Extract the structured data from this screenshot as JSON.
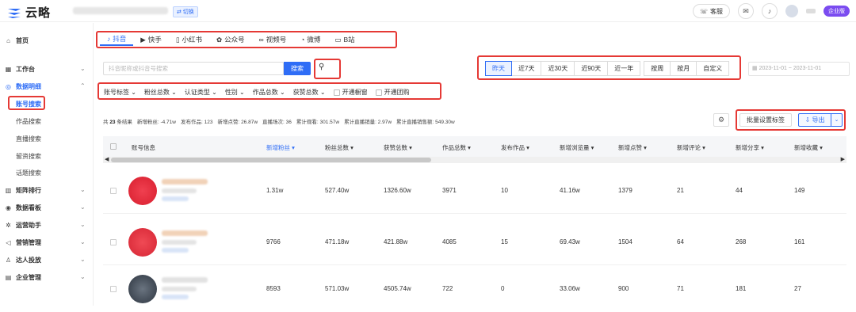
{
  "app": {
    "name": "云略",
    "switch_label": "⇄ 切换"
  },
  "topbar": {
    "service_label": "客服",
    "enterprise_label": "企业版"
  },
  "sidebar": {
    "home": "首页",
    "workbench": "工作台",
    "data_detail": "数据明细",
    "sub_items": [
      "账号搜索",
      "作品搜索",
      "直播搜索",
      "留资搜索",
      "话题搜索"
    ],
    "matrix": "矩阵排行",
    "dashboard": "数据看板",
    "ops": "运营助手",
    "marketing": "营销管理",
    "talent": "达人投放",
    "enterprise": "企业管理"
  },
  "tabs": [
    "抖音",
    "快手",
    "小红书",
    "公众号",
    "视频号",
    "微博",
    "B站"
  ],
  "search": {
    "placeholder": "抖音昵称或抖音号搜索",
    "button": "搜索"
  },
  "date_buttons": [
    "昨天",
    "近7天",
    "近30天",
    "近90天",
    "近一年",
    "按周",
    "按月",
    "自定义"
  ],
  "date_range": "2023-11-01 ~ 2023-11-01",
  "filters": [
    "账号标签",
    "粉丝总数",
    "认证类型",
    "性别",
    "作品总数",
    "获赞总数"
  ],
  "checks": [
    "开通橱窗",
    "开通团购"
  ],
  "summary": {
    "total_prefix": "共",
    "total_count": "23",
    "total_suffix": "条结果",
    "items": [
      "新增粉丝: -4.71w",
      "发布作品: 123",
      "新增点赞: 26.87w",
      "直播场次: 36",
      "累计观看: 301.57w",
      "累计直播销量: 2.97w",
      "累计直播销售额: 549.30w"
    ]
  },
  "actions": {
    "batch": "批量设置标签",
    "export": "导出"
  },
  "table": {
    "headers": [
      "账号信息",
      "新增粉丝 ▾",
      "粉丝总数 ▾",
      "获赞总数 ▾",
      "作品总数 ▾",
      "发布作品 ▾",
      "新增浏览量 ▾",
      "新增点赞 ▾",
      "新增评论 ▾",
      "新增分享 ▾",
      "新增收藏 ▾"
    ],
    "rows": [
      [
        "1.31w",
        "527.40w",
        "1326.60w",
        "3971",
        "10",
        "41.16w",
        "1379",
        "21",
        "44",
        "149"
      ],
      [
        "9766",
        "471.18w",
        "421.88w",
        "4085",
        "15",
        "69.43w",
        "1504",
        "64",
        "268",
        "161"
      ],
      [
        "8593",
        "571.03w",
        "4505.74w",
        "722",
        "0",
        "33.06w",
        "900",
        "71",
        "181",
        "27"
      ]
    ]
  },
  "colors": {
    "accent": "#2f6df6",
    "highlight": "#e53935",
    "enterprise": "#7b4cf0"
  }
}
